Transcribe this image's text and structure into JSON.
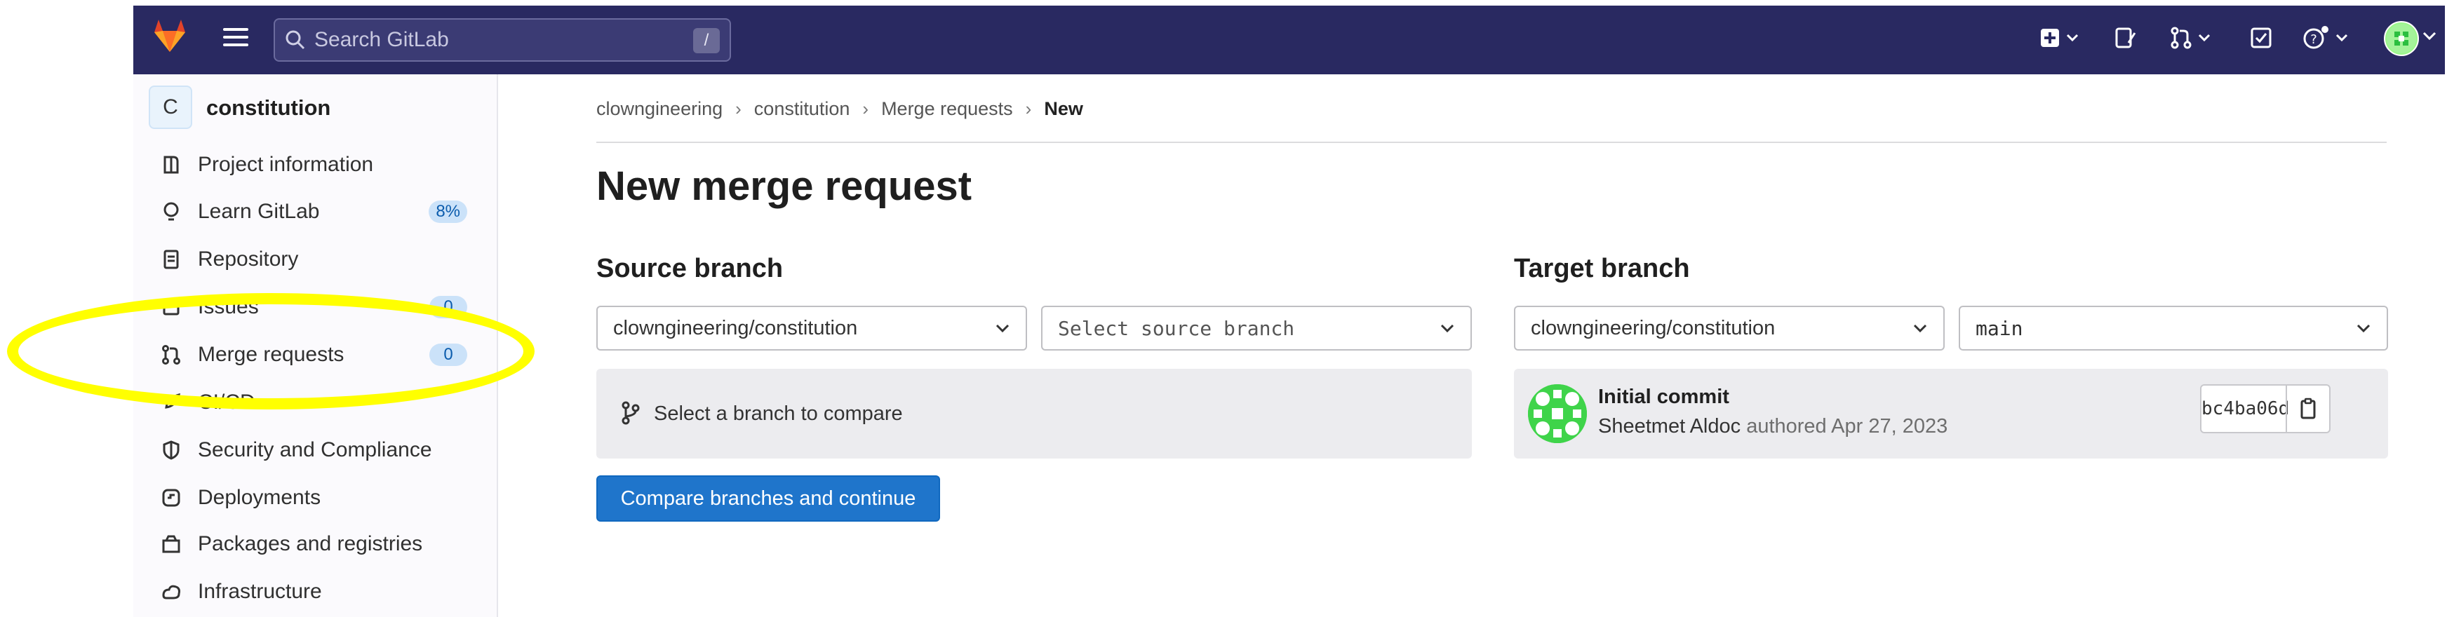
{
  "header": {
    "search_placeholder": "Search GitLab",
    "search_shortcut": "/"
  },
  "project": {
    "avatar_letter": "C",
    "name": "constitution"
  },
  "sidebar": {
    "items": [
      {
        "label": "Project information",
        "icon": "project-info-icon"
      },
      {
        "label": "Learn GitLab",
        "icon": "lightbulb-icon",
        "badge": "8%"
      },
      {
        "label": "Repository",
        "icon": "document-icon"
      },
      {
        "label": "Issues",
        "icon": "issues-icon",
        "badge": "0"
      },
      {
        "label": "Merge requests",
        "icon": "merge-request-icon",
        "badge": "0"
      },
      {
        "label": "CI/CD",
        "icon": "rocket-icon"
      },
      {
        "label": "Security and Compliance",
        "icon": "shield-icon"
      },
      {
        "label": "Deployments",
        "icon": "deployments-icon"
      },
      {
        "label": "Packages and registries",
        "icon": "package-icon"
      },
      {
        "label": "Infrastructure",
        "icon": "cloud-gear-icon"
      }
    ]
  },
  "breadcrumb": [
    "clowngineering",
    "constitution",
    "Merge requests",
    "New"
  ],
  "main": {
    "title": "New merge request",
    "source": {
      "heading": "Source branch",
      "project": "clowngineering/constitution",
      "branch_placeholder": "Select source branch",
      "compare_hint": "Select a branch to compare"
    },
    "target": {
      "heading": "Target branch",
      "project": "clowngineering/constitution",
      "branch": "main",
      "commit": {
        "title": "Initial commit",
        "author": "Sheetmet Aldoc",
        "authored_text": "authored Apr 27, 2023",
        "sha": "bc4ba06d"
      }
    },
    "compare_button": "Compare branches and continue"
  },
  "colors": {
    "topbar": "#292961",
    "primary_button": "#1f75cb",
    "highlight": "#ffff00",
    "badge_bg": "#cbe2f9"
  }
}
